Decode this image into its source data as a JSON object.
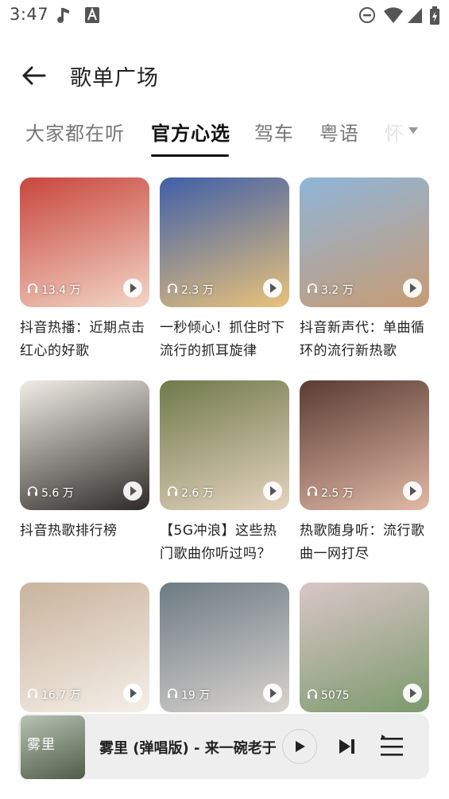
{
  "status_bar": {
    "time": "3:47",
    "left_icons": [
      "music-note-icon",
      "a-box-icon"
    ],
    "right_icons": [
      "do-not-disturb-icon",
      "wifi-icon",
      "signal-icon",
      "battery-charging-icon"
    ]
  },
  "header": {
    "title": "歌单广场"
  },
  "tabs": [
    {
      "label": "大家都在听"
    },
    {
      "label": "官方心选"
    },
    {
      "label": "驾车"
    },
    {
      "label": "粤语"
    },
    {
      "label": "怀"
    }
  ],
  "playlists": [
    {
      "plays": "13.4 万",
      "title": "抖音热播：近期点击红心的好歌",
      "colors": [
        "#c9463d",
        "#f2d6c6"
      ]
    },
    {
      "plays": "2.3 万",
      "title": "一秒倾心！抓住时下流行的抓耳旋律",
      "colors": [
        "#3f5fa8",
        "#e9c27a"
      ]
    },
    {
      "plays": "3.2 万",
      "title": "抖音新声代：单曲循环的流行新热歌",
      "colors": [
        "#8fb5d8",
        "#c89b74"
      ]
    },
    {
      "plays": "5.6 万",
      "title": "抖音热歌排行榜",
      "colors": [
        "#f1ede6",
        "#2e2a28"
      ]
    },
    {
      "plays": "2.6 万",
      "title": "【5G冲浪】这些热门歌曲你听过吗？",
      "colors": [
        "#6f7a4a",
        "#e6d4c0"
      ]
    },
    {
      "plays": "2.5 万",
      "title": "热歌随身听：流行歌曲一网打尽",
      "colors": [
        "#5a3c33",
        "#e2b9a6"
      ]
    },
    {
      "plays": "16.7 万",
      "title": "",
      "colors": [
        "#c9b39c",
        "#f5efe9"
      ]
    },
    {
      "plays": "19 万",
      "title": "",
      "colors": [
        "#6d7b84",
        "#d9d4cf"
      ]
    },
    {
      "plays": "5075",
      "title": "",
      "colors": [
        "#d9c6c8",
        "#7c9a6c"
      ]
    }
  ],
  "player": {
    "song": "雾里 (弹唱版) - 来一碗老于",
    "thumb_text": "雾里",
    "thumb_colors": [
      "#b8c3b3",
      "#4d5c48"
    ]
  }
}
